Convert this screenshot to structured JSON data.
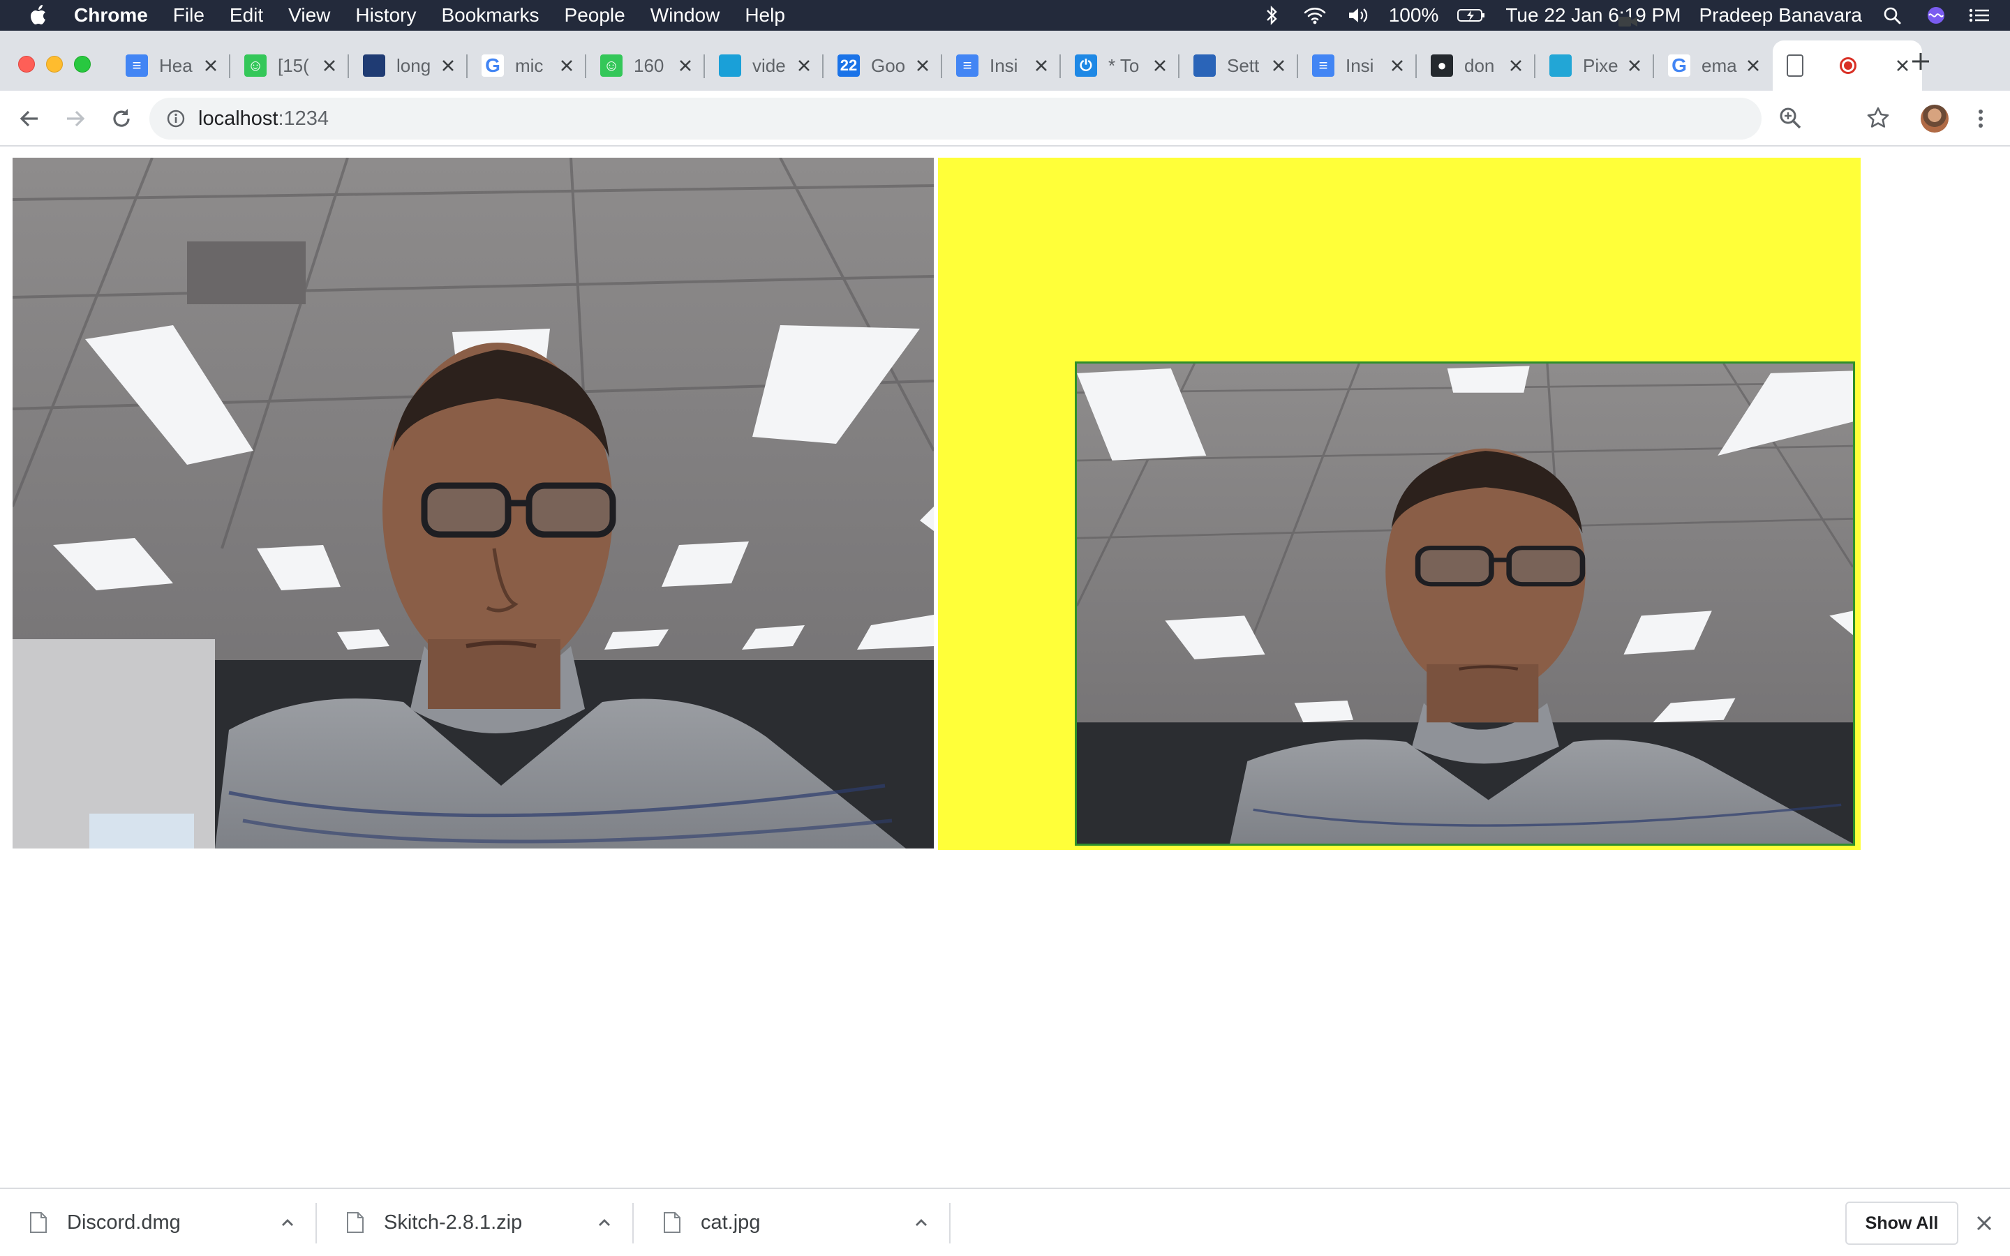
{
  "menubar": {
    "app_name": "Chrome",
    "menus": [
      "File",
      "Edit",
      "View",
      "History",
      "Bookmarks",
      "People",
      "Window",
      "Help"
    ],
    "battery": "100%",
    "clock": "Tue 22 Jan  6:19 PM",
    "user": "Pradeep Banavara"
  },
  "tabs": [
    {
      "title": "Hea",
      "icon": "google-docs-icon",
      "color": "#4285f4"
    },
    {
      "title": "[15(",
      "icon": "smiley-icon",
      "color": "#34c759"
    },
    {
      "title": "long",
      "icon": "site-icon",
      "color": "#1f3b73"
    },
    {
      "title": "mic",
      "icon": "google-icon",
      "color": "#4285f4"
    },
    {
      "title": "160",
      "icon": "smiley-icon",
      "color": "#34c759"
    },
    {
      "title": "vide",
      "icon": "site-icon",
      "color": "#1aa0d8"
    },
    {
      "title": "Goo",
      "icon": "calendar-icon",
      "color": "#1a73e8"
    },
    {
      "title": "Insi",
      "icon": "google-docs-icon",
      "color": "#4285f4"
    },
    {
      "title": "* To",
      "icon": "power-icon",
      "color": "#1e88e5"
    },
    {
      "title": "Sett",
      "icon": "site-icon",
      "color": "#2a64b8"
    },
    {
      "title": "Insi",
      "icon": "google-docs-icon",
      "color": "#4285f4"
    },
    {
      "title": "don",
      "icon": "github-icon",
      "color": "#24292e"
    },
    {
      "title": "Pixe",
      "icon": "site-icon",
      "color": "#22a6d6"
    },
    {
      "title": "ema",
      "icon": "google-icon",
      "color": "#4285f4"
    },
    {
      "title": "",
      "icon": "page-icon",
      "color": "#5f6368",
      "active": true,
      "recording": true
    }
  ],
  "omnibox": {
    "host": "localhost",
    "port": ":1234"
  },
  "content": {
    "canvas_background": "#ffff39",
    "inner_border": "#2f8f2a"
  },
  "downloads": [
    {
      "name": "Discord.dmg"
    },
    {
      "name": "Skitch-2.8.1.zip"
    },
    {
      "name": "cat.jpg"
    }
  ],
  "shelf": {
    "show_all_label": "Show All"
  }
}
